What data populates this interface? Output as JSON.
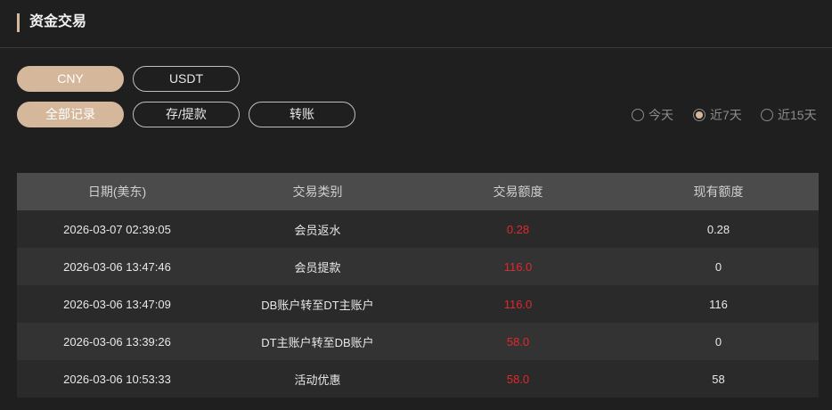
{
  "header": {
    "title": "资金交易"
  },
  "currency_tabs": [
    {
      "label": "CNY",
      "active": true
    },
    {
      "label": "USDT",
      "active": false
    }
  ],
  "record_tabs": [
    {
      "label": "全部记录",
      "active": true
    },
    {
      "label": "存/提款",
      "active": false
    },
    {
      "label": "转账",
      "active": false
    }
  ],
  "date_filter": [
    {
      "label": "今天",
      "selected": false
    },
    {
      "label": "近7天",
      "selected": true
    },
    {
      "label": "近15天",
      "selected": false
    }
  ],
  "table": {
    "headers": {
      "date": "日期(美东)",
      "type": "交易类别",
      "amount": "交易额度",
      "balance": "现有额度"
    },
    "rows": [
      {
        "date": "2026-03-07 02:39:05",
        "type": "会员返水",
        "amount": "0.28",
        "balance": "0.28"
      },
      {
        "date": "2026-03-06 13:47:46",
        "type": "会员提款",
        "amount": "116.0",
        "balance": "0"
      },
      {
        "date": "2026-03-06 13:47:09",
        "type": "DB账户转至DT主账户",
        "amount": "116.0",
        "balance": "116"
      },
      {
        "date": "2026-03-06 13:39:26",
        "type": "DT主账户转至DB账户",
        "amount": "58.0",
        "balance": "0"
      },
      {
        "date": "2026-03-06 10:53:33",
        "type": "活动优惠",
        "amount": "58.0",
        "balance": "58"
      }
    ]
  },
  "colors": {
    "accent": "#d5b79c",
    "amount": "#e2282d",
    "background": "#1f1f1f"
  }
}
